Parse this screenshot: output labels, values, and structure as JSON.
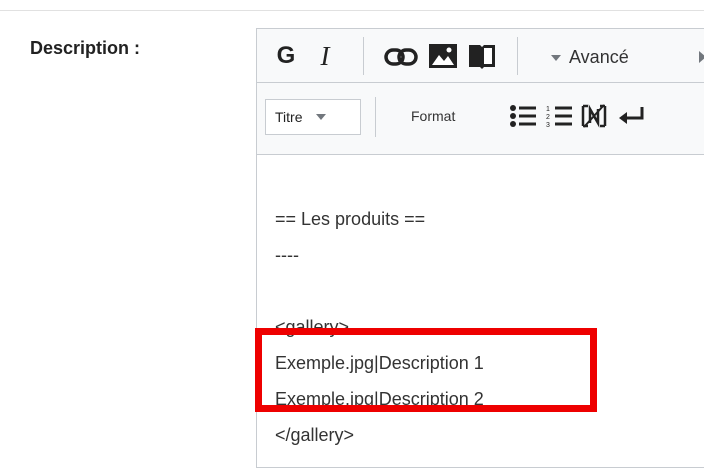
{
  "form": {
    "label": "Description :"
  },
  "toolbar": {
    "bold_label": "G",
    "italic_label": "I",
    "advanced_label": "Avancé",
    "heading_select_value": "Titre",
    "format_label": "Format",
    "icons": {
      "link": "link-icon",
      "image": "image-icon",
      "book": "book-icon",
      "bullet_list": "bullet-list-icon",
      "numbered_list": "numbered-list-icon",
      "nowiki": "nowiki-icon",
      "newline": "newline-icon"
    }
  },
  "editor": {
    "lines": [
      "",
      "== Les produits ==",
      "----",
      "",
      "<gallery>",
      "Exemple.jpg|Description 1",
      "Exemple.jpg|Description 2",
      "</gallery>"
    ]
  },
  "annotation": {
    "highlight_color": "#ee0000"
  }
}
